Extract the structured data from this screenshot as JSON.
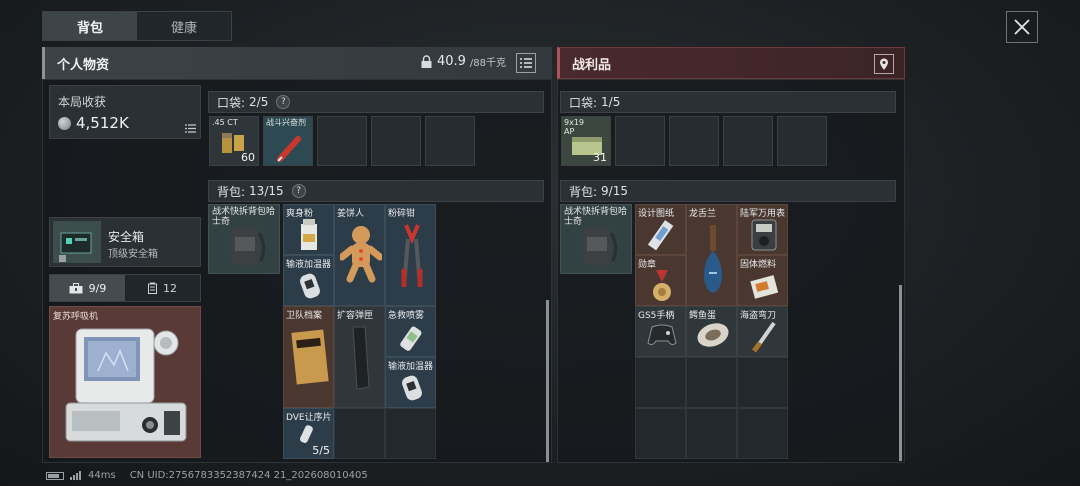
{
  "tabs": [
    {
      "label": "背包"
    },
    {
      "label": "健康"
    }
  ],
  "left_panel": {
    "title": "个人物资",
    "weight": "40.9",
    "weight_max": "/88千克",
    "earnings": {
      "label": "本局收获",
      "value": "4,512K"
    },
    "safe_box": {
      "title": "安全箱",
      "subtitle": "顶级安全箱"
    },
    "subtabs": [
      {
        "label": "9/9"
      },
      {
        "label": "12"
      }
    ],
    "equipped": {
      "label": "复苏呼吸机"
    },
    "pocket": {
      "label": "口袋:",
      "count": "2/5",
      "help": "?"
    },
    "pocket_items": [
      {
        "label": ".45 CT",
        "count": "60"
      },
      {
        "label": "战斗兴奋剂",
        "count": ""
      }
    ],
    "backpack": {
      "label": "背包:",
      "count": "13/15",
      "help": "?"
    },
    "backpack_equipped": {
      "label": "战术快拆背包哈士奇"
    },
    "backpack_items": [
      {
        "label": "爽身粉"
      },
      {
        "label": "姜饼人"
      },
      {
        "label": "粉碎钳"
      },
      {
        "label": "输液加温器"
      },
      {
        "label": "卫队档案"
      },
      {
        "label": "扩容弹匣"
      },
      {
        "label": "急救喷雾"
      },
      {
        "label": "输液加温器"
      },
      {
        "label": "DVE让序片",
        "count": "5/5"
      }
    ]
  },
  "right_panel": {
    "title": "战利品",
    "pocket": {
      "label": "口袋:",
      "count": "1/5"
    },
    "pocket_items": [
      {
        "label": "9x19 AP",
        "count": "31"
      }
    ],
    "backpack": {
      "label": "背包:",
      "count": "9/15"
    },
    "backpack_equipped": {
      "label": "战术快拆背包哈士奇"
    },
    "backpack_items": [
      {
        "label": "设计图纸"
      },
      {
        "label": "龙舌兰"
      },
      {
        "label": "陆军万用表"
      },
      {
        "label": "勋章"
      },
      {
        "label": "固体燃料"
      },
      {
        "label": "GS5手柄"
      },
      {
        "label": "鳄鱼蛋"
      },
      {
        "label": "海盗弯刀"
      }
    ]
  },
  "status_bar": {
    "ping": "44ms",
    "uid": "CN UID:2756783352387424 21_202608010405"
  }
}
